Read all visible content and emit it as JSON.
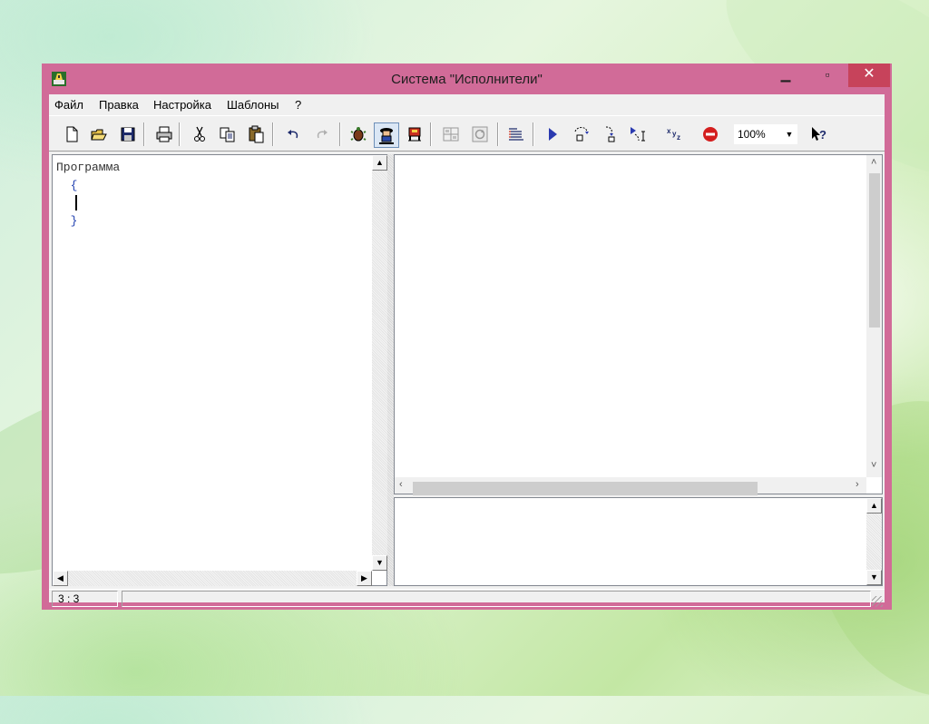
{
  "window": {
    "title": "Система \"Исполнители\"",
    "controls": {
      "minimize": "▁",
      "maximize": "▫",
      "close": "✕"
    }
  },
  "menu": [
    {
      "label": "Файл",
      "id": "file"
    },
    {
      "label": "Правка",
      "id": "edit"
    },
    {
      "label": "Настройка",
      "id": "settings"
    },
    {
      "label": "Шаблоны",
      "id": "templates"
    },
    {
      "label": "?",
      "id": "help"
    }
  ],
  "toolbar": {
    "icons": [
      "new-file-icon",
      "open-folder-icon",
      "save-icon",
      "print-icon",
      "cut-icon",
      "copy-icon",
      "paste-icon",
      "undo-icon",
      "redo-icon",
      "performer-turtle-icon",
      "performer-robot-icon",
      "performer-drawer-icon",
      "grid-icon",
      "refresh-icon",
      "structure-icon",
      "run-icon",
      "step-into-icon",
      "step-over-icon",
      "step-out-icon",
      "variables-icon",
      "stop-icon",
      "context-help-icon"
    ],
    "zoom_value": "100%"
  },
  "editor": {
    "lines": [
      "Программа",
      "  {",
      "",
      "  }"
    ]
  },
  "status": {
    "position": "3 : 3"
  },
  "colors": {
    "window_frame": "#d16b98",
    "close_button": "#c7435b",
    "code_brace": "#1f3fb0",
    "client_bg": "#f0f0f0"
  }
}
